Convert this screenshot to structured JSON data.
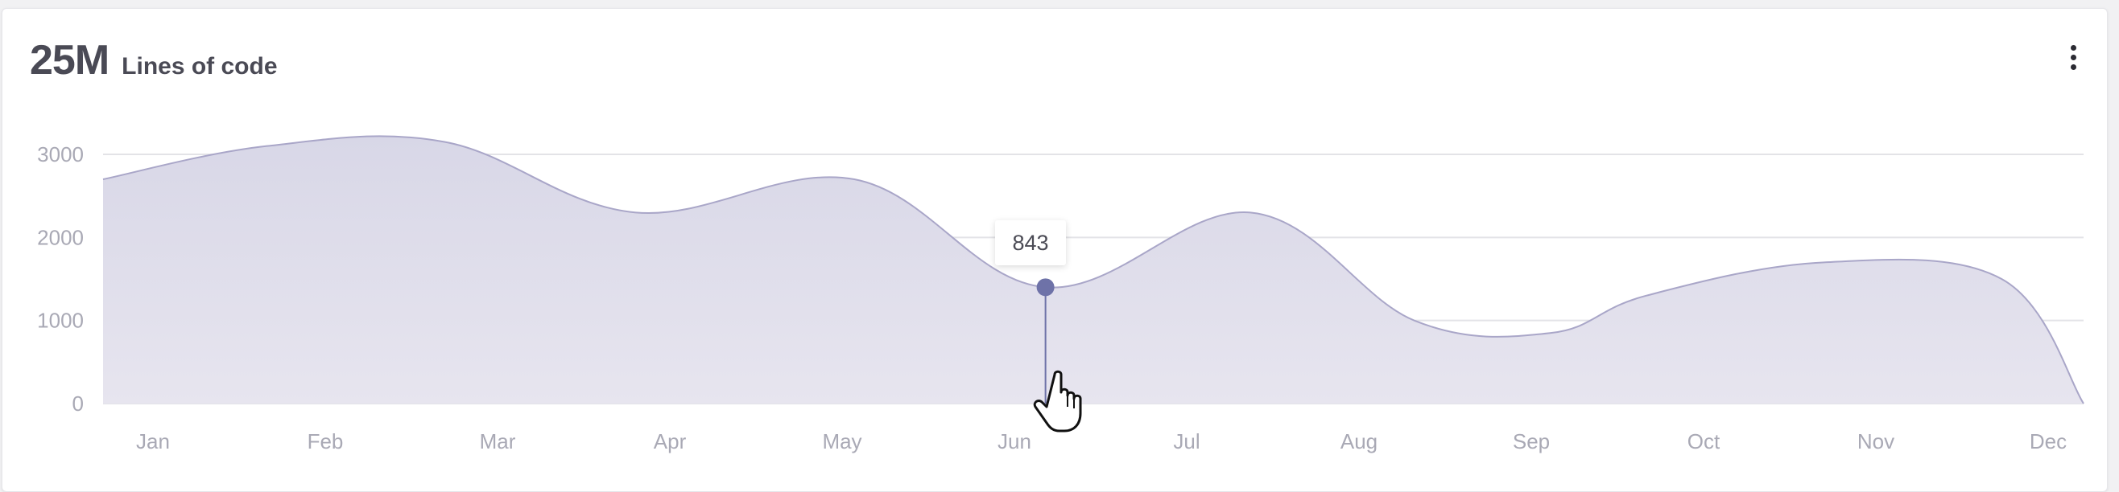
{
  "card": {
    "value": "25M",
    "label": "Lines of code"
  },
  "tooltip": {
    "value": "843"
  },
  "colors": {
    "area_fill": "#dddbea",
    "line": "#a9a6c8",
    "marker": "#6e72a8",
    "grid": "#e3e3e7"
  },
  "chart_data": {
    "type": "area",
    "title": "",
    "xlabel": "",
    "ylabel": "",
    "ylim": [
      0,
      3000
    ],
    "yticks": [
      0,
      1000,
      2000,
      3000
    ],
    "categories": [
      "Jan",
      "Feb",
      "Mar",
      "Apr",
      "May",
      "Jun",
      "Jul",
      "Aug",
      "Sep",
      "Oct",
      "Nov",
      "Dec"
    ],
    "series": [
      {
        "x": [
          0,
          1.2,
          2.5,
          3.9,
          5.5,
          6.9,
          8.4,
          9.6,
          10.6,
          11.3,
          12.6,
          13.9,
          14.5
        ],
        "values": [
          2700,
          3100,
          3150,
          2300,
          2700,
          1400,
          2300,
          1000,
          850,
          1300,
          1700,
          1500,
          0
        ]
      }
    ],
    "highlight": {
      "category": "Jun",
      "x": 6.9,
      "value": 1400,
      "label": "843"
    },
    "grid": true,
    "legend": "none"
  }
}
